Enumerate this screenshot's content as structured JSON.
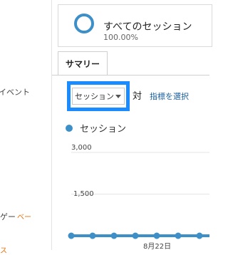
{
  "sidebar": {
    "events_label": "イベント",
    "segment_label_partial": "ゲー",
    "segment_beta": "ベー",
    "bottom_label": "ス"
  },
  "segment_card": {
    "name": "すべてのセッション",
    "percent": "100.00%",
    "ring_color": "#3d8fc8"
  },
  "tabs": {
    "summary": "サマリー"
  },
  "controls": {
    "metric_selected": "セッション",
    "versus": "対",
    "select_metric_link": "指標を選択",
    "highlight_color": "#1a8cff"
  },
  "legend": {
    "series_name": "セッション",
    "color": "#3d8fc8"
  },
  "chart_data": {
    "type": "line",
    "y_ticks": [
      "3,000",
      "1,500"
    ],
    "x_ticks": [
      "8月22日"
    ],
    "ylim": [
      0,
      3000
    ],
    "series": [
      {
        "name": "セッション",
        "values": [
          0,
          0,
          0,
          0,
          0,
          0,
          0,
          0,
          0,
          0,
          150
        ]
      }
    ],
    "grid": true
  }
}
